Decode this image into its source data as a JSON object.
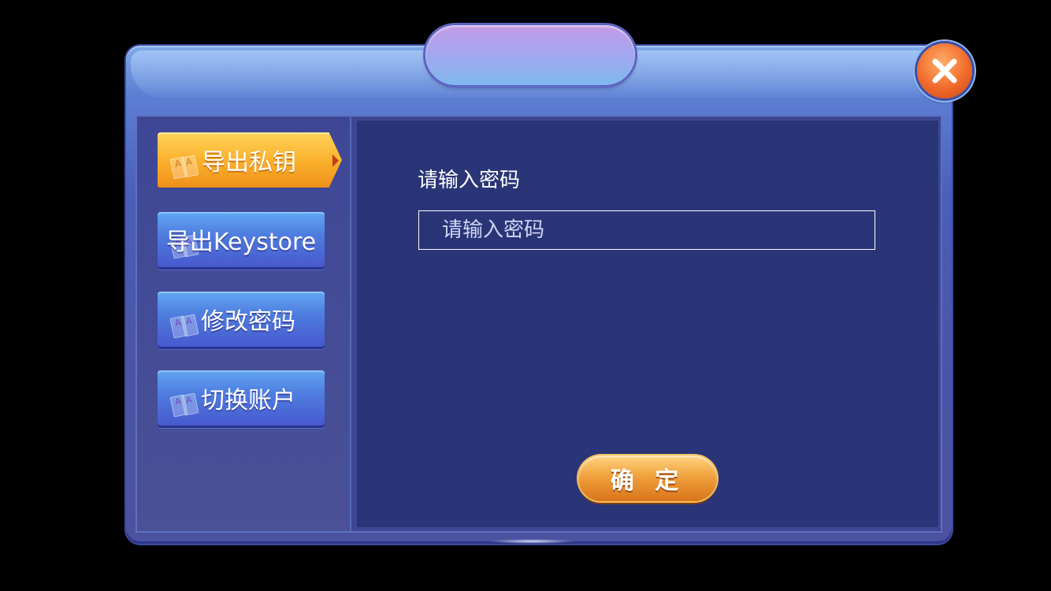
{
  "sidebar": {
    "items": [
      {
        "label": "导出私钥",
        "active": true
      },
      {
        "label": "导出Keystore",
        "active": false
      },
      {
        "label": "修改密码",
        "active": false
      },
      {
        "label": "切换账户",
        "active": false
      }
    ]
  },
  "main": {
    "password_label": "请输入密码",
    "password_placeholder": "请输入密码",
    "confirm_label": "确 定"
  },
  "icons": {
    "close": "close-icon",
    "tab_card": "playing-cards-icon"
  },
  "colors": {
    "active_tab": "#fbb22e",
    "tab": "#4f7ee0",
    "content_bg": "#2a3577",
    "close": "#f16a2a",
    "confirm": "#f0a23c"
  }
}
